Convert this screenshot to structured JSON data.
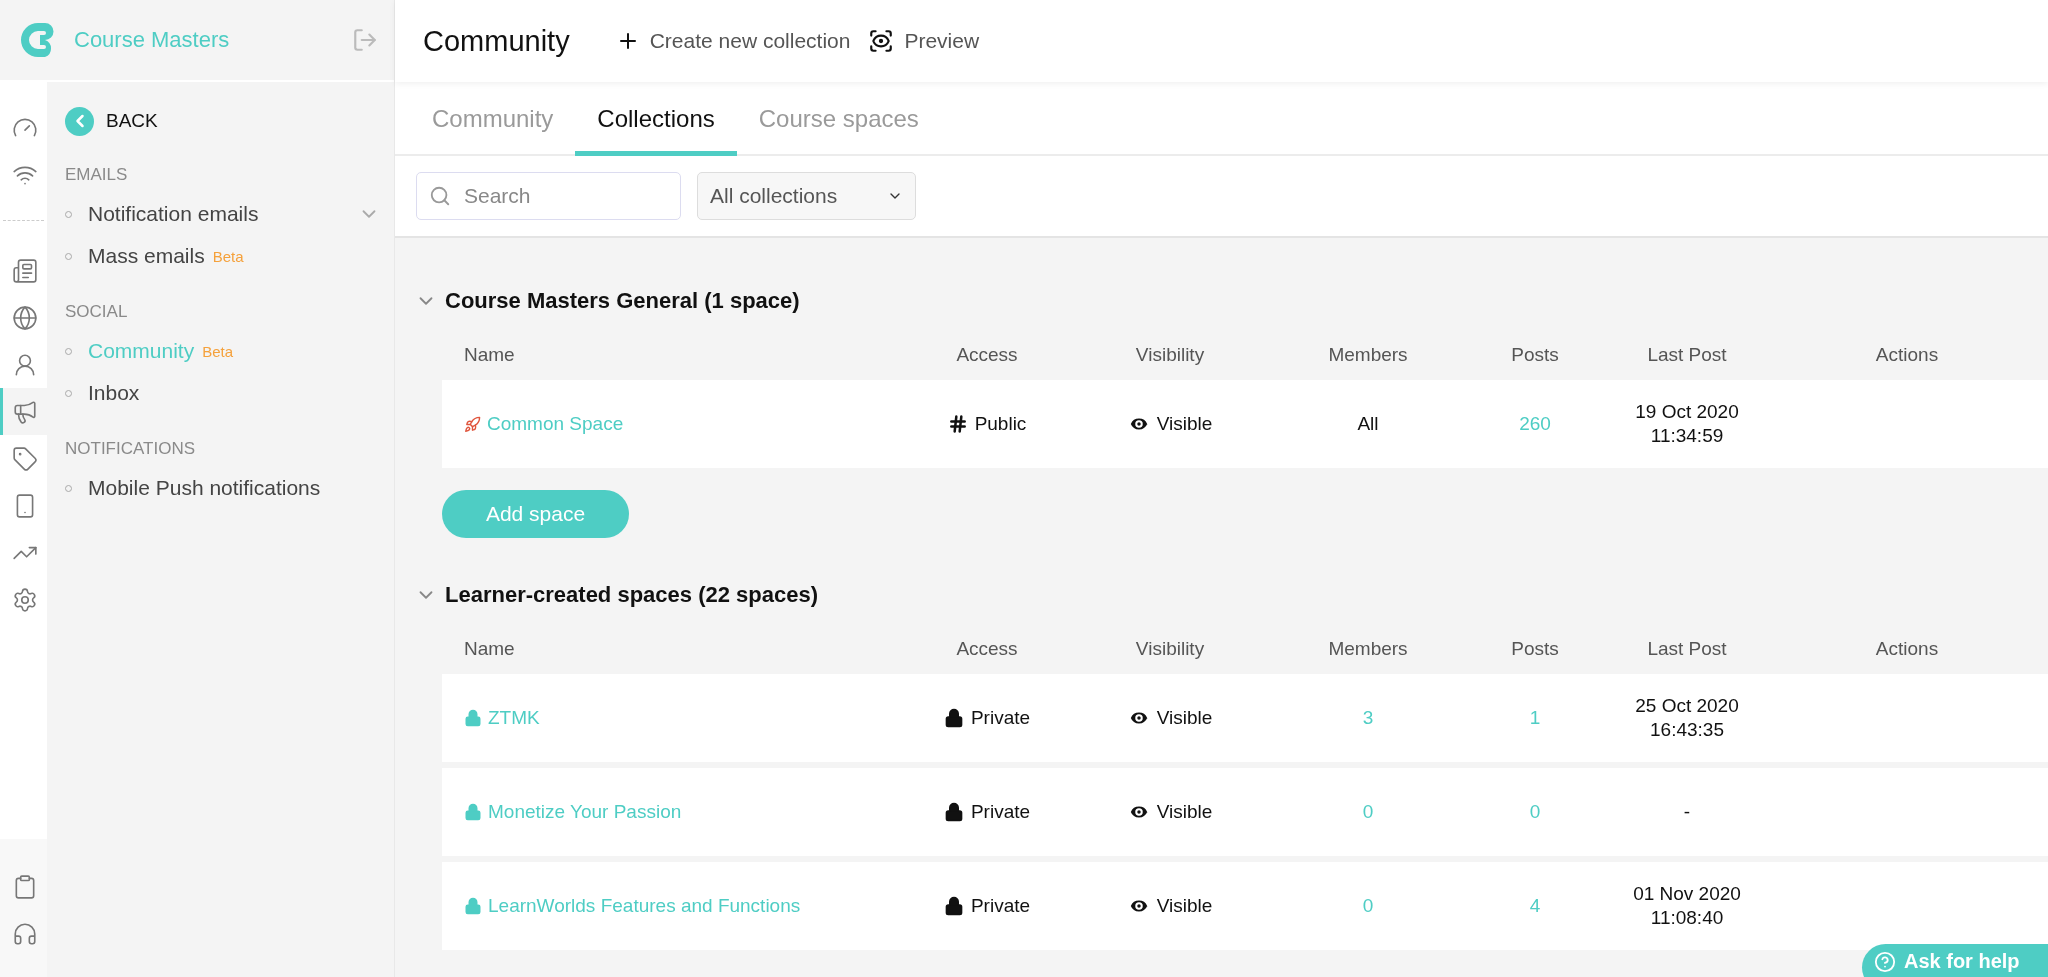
{
  "brand": {
    "name": "Course Masters"
  },
  "rail": {
    "top": [
      {
        "selected": false
      },
      {
        "selected": false
      }
    ],
    "main": [
      {
        "selected": false
      },
      {
        "selected": false
      },
      {
        "selected": false
      },
      {
        "selected": true
      },
      {
        "selected": false
      },
      {
        "selected": false
      },
      {
        "selected": false
      },
      {
        "selected": false
      }
    ],
    "bottom": [
      {
        "selected": false
      },
      {
        "selected": false
      }
    ]
  },
  "nav": {
    "back": "BACK",
    "sections": [
      {
        "title": "EMAILS",
        "items": [
          {
            "label": "Notification emails",
            "selected": false,
            "expanded": false
          },
          {
            "label": "Mass emails",
            "badge": "Beta",
            "selected": false
          }
        ]
      },
      {
        "title": "SOCIAL",
        "items": [
          {
            "label": "Community",
            "badge": "Beta",
            "selected": true
          },
          {
            "label": "Inbox",
            "selected": false
          }
        ]
      },
      {
        "title": "NOTIFICATIONS",
        "items": [
          {
            "label": "Mobile Push notifications",
            "selected": false
          }
        ]
      }
    ]
  },
  "header": {
    "title": "Community",
    "actions": [
      {
        "kind": "create",
        "label": "Create new collection"
      },
      {
        "kind": "preview",
        "label": "Preview"
      }
    ]
  },
  "tabs": [
    {
      "label": "Community",
      "selected": false
    },
    {
      "label": "Collections",
      "selected": true
    },
    {
      "label": "Course spaces",
      "selected": false
    }
  ],
  "search": {
    "placeholder": "Search"
  },
  "filter": {
    "value": "All collections"
  },
  "groups": [
    {
      "title": "Course Masters General (1 space)",
      "expanded": true,
      "button": "Add space",
      "columns": [
        "Name",
        "Access",
        "Visibility",
        "Members",
        "Posts",
        "Last Post",
        "Actions"
      ],
      "rows": [
        {
          "name": "Common Space",
          "kind": "rocket",
          "access": {
            "kind": "public",
            "label": "Public"
          },
          "visibility": "Visible",
          "members": {
            "text": "All",
            "link": false
          },
          "posts": "260",
          "last_post": [
            "19 Oct 2020",
            "11:34:59"
          ]
        }
      ]
    },
    {
      "title": "Learner-created spaces (22 spaces)",
      "expanded": true,
      "columns": [
        "Name",
        "Access",
        "Visibility",
        "Members",
        "Posts",
        "Last Post",
        "Actions"
      ],
      "rows": [
        {
          "name": "ZTMK",
          "kind": "lock",
          "access": {
            "kind": "private",
            "label": "Private"
          },
          "visibility": "Visible",
          "members": {
            "text": "3",
            "link": true
          },
          "posts": "1",
          "last_post": [
            "25 Oct 2020",
            "16:43:35"
          ]
        },
        {
          "name": "Monetize Your Passion",
          "kind": "lock",
          "access": {
            "kind": "private",
            "label": "Private"
          },
          "visibility": "Visible",
          "members": {
            "text": "0",
            "link": true
          },
          "posts": "0",
          "last_post": [
            "-"
          ]
        },
        {
          "name": "LearnWorlds Features and Functions",
          "kind": "lock",
          "access": {
            "kind": "private",
            "label": "Private"
          },
          "visibility": "Visible",
          "members": {
            "text": "0",
            "link": true
          },
          "posts": "4",
          "last_post": [
            "01 Nov 2020",
            "11:08:40"
          ]
        }
      ]
    }
  ],
  "help": {
    "label": "Ask for help"
  }
}
